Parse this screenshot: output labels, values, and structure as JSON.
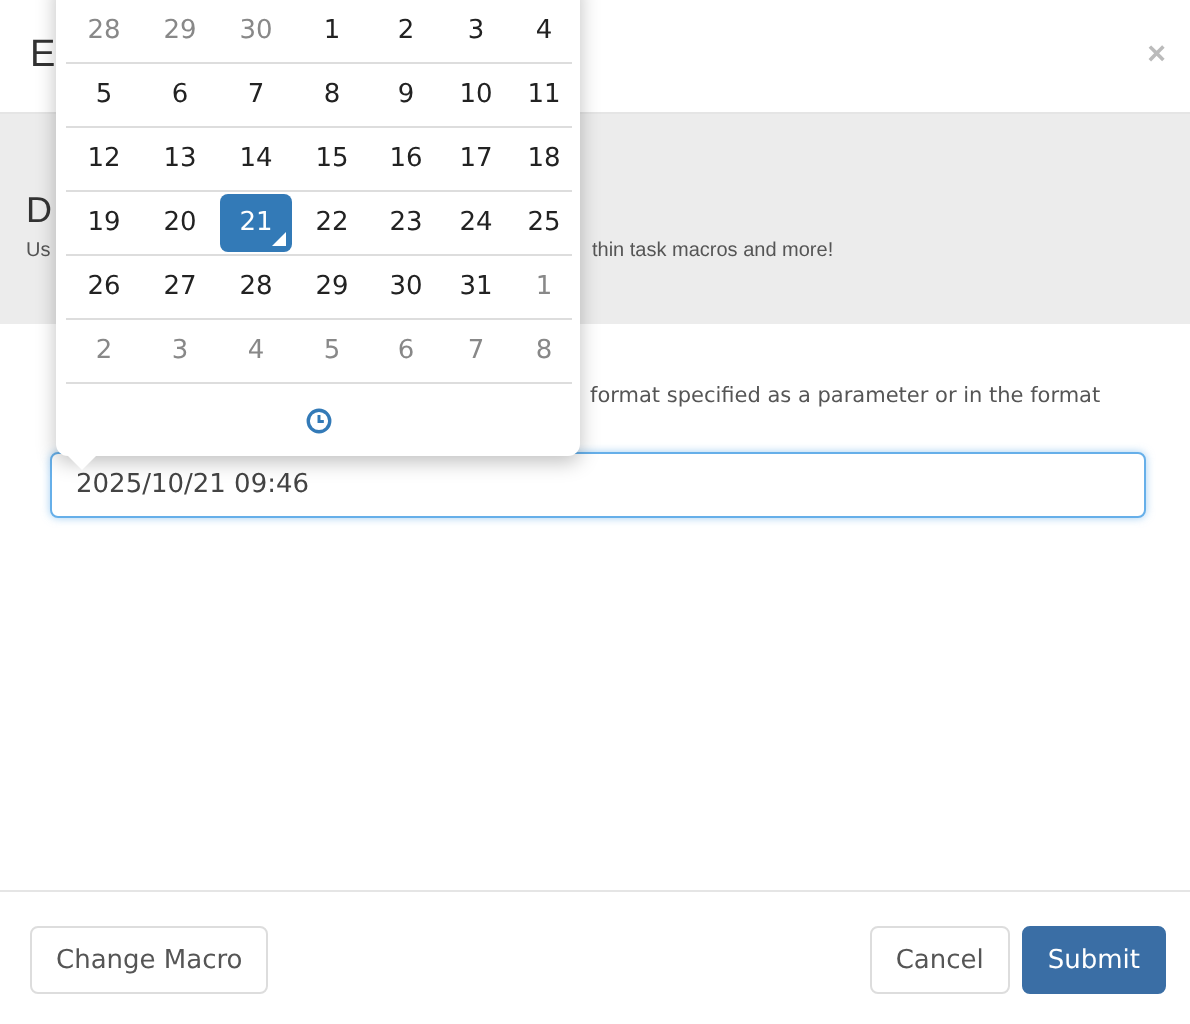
{
  "modal": {
    "title_fragment": "E",
    "close": "×",
    "banner": {
      "heading_fragment": "D",
      "text_fragments": [
        "Us",
        "thin task macros and more!"
      ]
    },
    "description_fragments": [
      "format specified as a parameter or in the format"
    ],
    "input": {
      "value": "2025/10/21 09:46",
      "focused": true
    },
    "left_buttons": [
      {
        "label": "Change Macro",
        "kind": "default"
      }
    ],
    "right_buttons": [
      {
        "label": "Cancel",
        "kind": "default"
      },
      {
        "label": "Submit",
        "kind": "primary"
      }
    ]
  },
  "datepicker": {
    "weeks": [
      [
        {
          "day": "28",
          "muted": true,
          "selected": false
        },
        {
          "day": "29",
          "muted": true,
          "selected": false
        },
        {
          "day": "30",
          "muted": true,
          "selected": false
        },
        {
          "day": "1",
          "muted": false,
          "selected": false
        },
        {
          "day": "2",
          "muted": false,
          "selected": false
        },
        {
          "day": "3",
          "muted": false,
          "selected": false
        },
        {
          "day": "4",
          "muted": false,
          "selected": false
        }
      ],
      [
        {
          "day": "5",
          "muted": false,
          "selected": false
        },
        {
          "day": "6",
          "muted": false,
          "selected": false
        },
        {
          "day": "7",
          "muted": false,
          "selected": false
        },
        {
          "day": "8",
          "muted": false,
          "selected": false
        },
        {
          "day": "9",
          "muted": false,
          "selected": false
        },
        {
          "day": "10",
          "muted": false,
          "selected": false
        },
        {
          "day": "11",
          "muted": false,
          "selected": false
        }
      ],
      [
        {
          "day": "12",
          "muted": false,
          "selected": false
        },
        {
          "day": "13",
          "muted": false,
          "selected": false
        },
        {
          "day": "14",
          "muted": false,
          "selected": false
        },
        {
          "day": "15",
          "muted": false,
          "selected": false
        },
        {
          "day": "16",
          "muted": false,
          "selected": false
        },
        {
          "day": "17",
          "muted": false,
          "selected": false
        },
        {
          "day": "18",
          "muted": false,
          "selected": false
        }
      ],
      [
        {
          "day": "19",
          "muted": false,
          "selected": false
        },
        {
          "day": "20",
          "muted": false,
          "selected": false
        },
        {
          "day": "21",
          "muted": false,
          "selected": true
        },
        {
          "day": "22",
          "muted": false,
          "selected": false
        },
        {
          "day": "23",
          "muted": false,
          "selected": false
        },
        {
          "day": "24",
          "muted": false,
          "selected": false
        },
        {
          "day": "25",
          "muted": false,
          "selected": false
        }
      ],
      [
        {
          "day": "26",
          "muted": false,
          "selected": false
        },
        {
          "day": "27",
          "muted": false,
          "selected": false
        },
        {
          "day": "28",
          "muted": false,
          "selected": false
        },
        {
          "day": "29",
          "muted": false,
          "selected": false
        },
        {
          "day": "30",
          "muted": false,
          "selected": false
        },
        {
          "day": "31",
          "muted": false,
          "selected": false
        },
        {
          "day": "1",
          "muted": true,
          "selected": false
        }
      ],
      [
        {
          "day": "2",
          "muted": true,
          "selected": false
        },
        {
          "day": "3",
          "muted": true,
          "selected": false
        },
        {
          "day": "4",
          "muted": true,
          "selected": false
        },
        {
          "day": "5",
          "muted": true,
          "selected": false
        },
        {
          "day": "6",
          "muted": true,
          "selected": false
        },
        {
          "day": "7",
          "muted": true,
          "selected": false
        },
        {
          "day": "8",
          "muted": true,
          "selected": false
        }
      ]
    ]
  }
}
